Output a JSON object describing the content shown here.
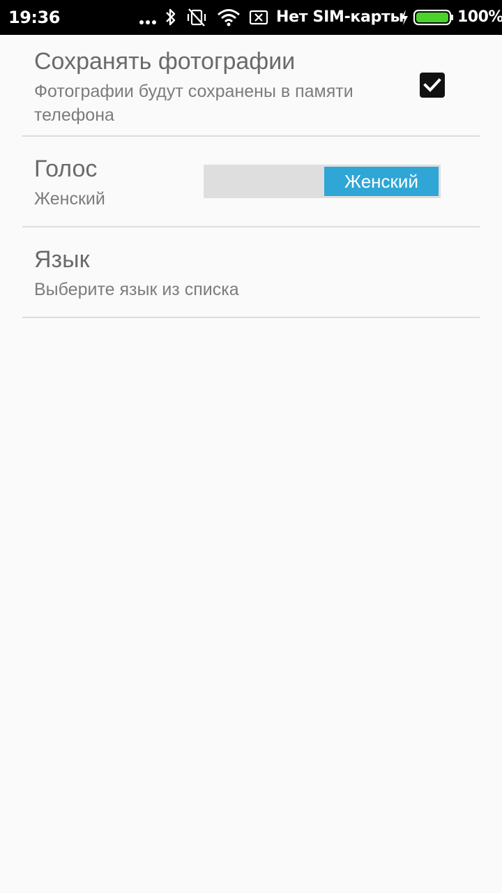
{
  "status_bar": {
    "time": "19:36",
    "carrier": "Нет SIM-карты",
    "battery": "100%",
    "icons": [
      "more-dots-icon",
      "bluetooth-icon",
      "vibrate-off-icon",
      "wifi-icon",
      "no-sim-icon",
      "charging-bolt-icon",
      "battery-icon"
    ],
    "battery_color": "#4cd22c"
  },
  "settings": {
    "save_photos": {
      "title": "Сохранять фотографии",
      "summary": "Фотографии будут сохранены в памяти телефона",
      "checked": true
    },
    "voice": {
      "title": "Голос",
      "summary": "Женский",
      "switch_label": "Женский",
      "accent": "#2fa6d6"
    },
    "language": {
      "title": "Язык",
      "summary": "Выберите язык из списка"
    }
  }
}
